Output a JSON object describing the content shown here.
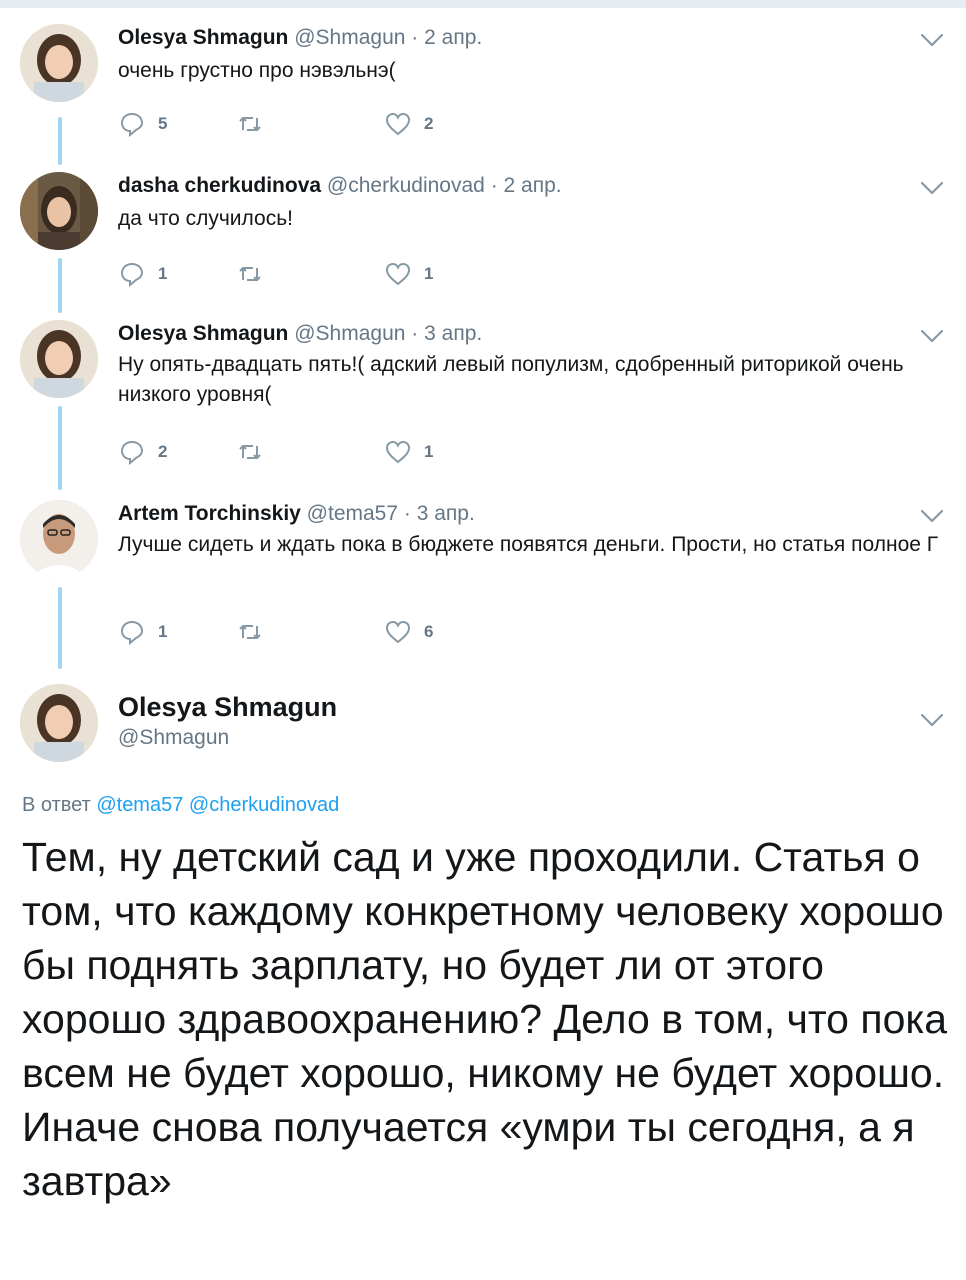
{
  "colors": {
    "accent": "#1da1f2",
    "thread_line": "#9fd6f5",
    "secondary_text": "#657786"
  },
  "tweets": [
    {
      "name": "Olesya Shmagun",
      "handle": "@Shmagun",
      "sep": "·",
      "date": "2 апр.",
      "text": "очень грустно про нэвэльнэ(",
      "replies": "5",
      "retweets": "",
      "likes": "2"
    },
    {
      "name": "dasha cherkudinova",
      "handle": "@cherkudinovad",
      "sep": "·",
      "date": "2 апр.",
      "text": "да что случилось!",
      "replies": "1",
      "retweets": "",
      "likes": "1"
    },
    {
      "name": "Olesya Shmagun",
      "handle": "@Shmagun",
      "sep": "·",
      "date": "3 апр.",
      "text": "Ну опять-двадцать пять!( адский левый популизм, сдобренный риторикой очень низкого уровня(",
      "replies": "2",
      "retweets": "",
      "likes": "1"
    },
    {
      "name": "Artem Torchinskiy",
      "handle": "@tema57",
      "sep": "·",
      "date": "3 апр.",
      "text": "Лучше сидеть и ждать пока в бюджете появятся деньги. Прости, но статья полное Г",
      "replies": "1",
      "retweets": "",
      "likes": "6"
    }
  ],
  "main_tweet": {
    "name": "Olesya Shmagun",
    "handle": "@Shmagun",
    "reply_prefix": "В ответ",
    "reply_mentions": [
      "@tema57",
      "@cherkudinovad"
    ],
    "text": "Тем, ну детский сад и уже проходили. Статья о том, что каждому конкретному человеку хорошо бы поднять зарплату, но будет ли от этого хорошо здравоохранению? Дело в том, что пока всем не будет хорошо, никому не будет хорошо. Иначе снова получается «умри ты сегодня, а я завтра»"
  }
}
